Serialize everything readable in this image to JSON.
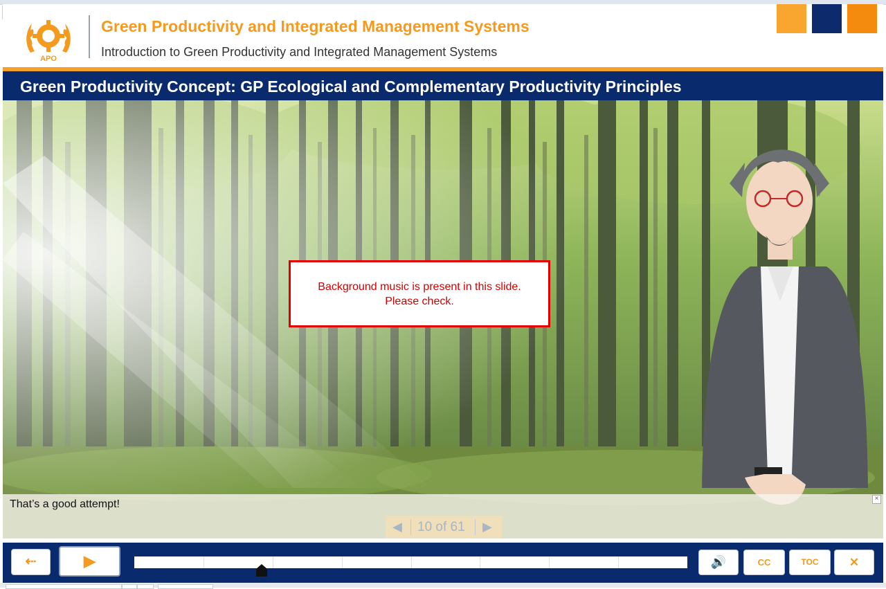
{
  "header": {
    "course_title": "Green Productivity and Integrated Management Systems",
    "course_subtitle": "Introduction to Green Productivity and Integrated Management Systems",
    "logo_text": "APO",
    "expand_label": "»"
  },
  "slide": {
    "title": "Green Productivity Concept: GP Ecological and Complementary Productivity Principles",
    "notice_line1": "Background music is present in this slide.",
    "notice_line2": "Please check."
  },
  "caption": {
    "text": "That’s a good attempt!",
    "close_label": "×"
  },
  "navigation": {
    "prev_label": "◀",
    "counter": "10 of 61",
    "next_label": "▶",
    "current_slide": 10,
    "total_slides": 61
  },
  "controls": {
    "exit_label": "⇠",
    "play_label": "▶",
    "volume_label": "🔊",
    "cc_label": "CC",
    "toc_label": "TOC",
    "close_label": "✕",
    "progress_fraction": 0.23
  },
  "colors": {
    "brand_navy": "#0a2a6e",
    "brand_orange": "#f39a1f",
    "notice_red": "#e00000",
    "forest_green": "#6f9a3c"
  }
}
